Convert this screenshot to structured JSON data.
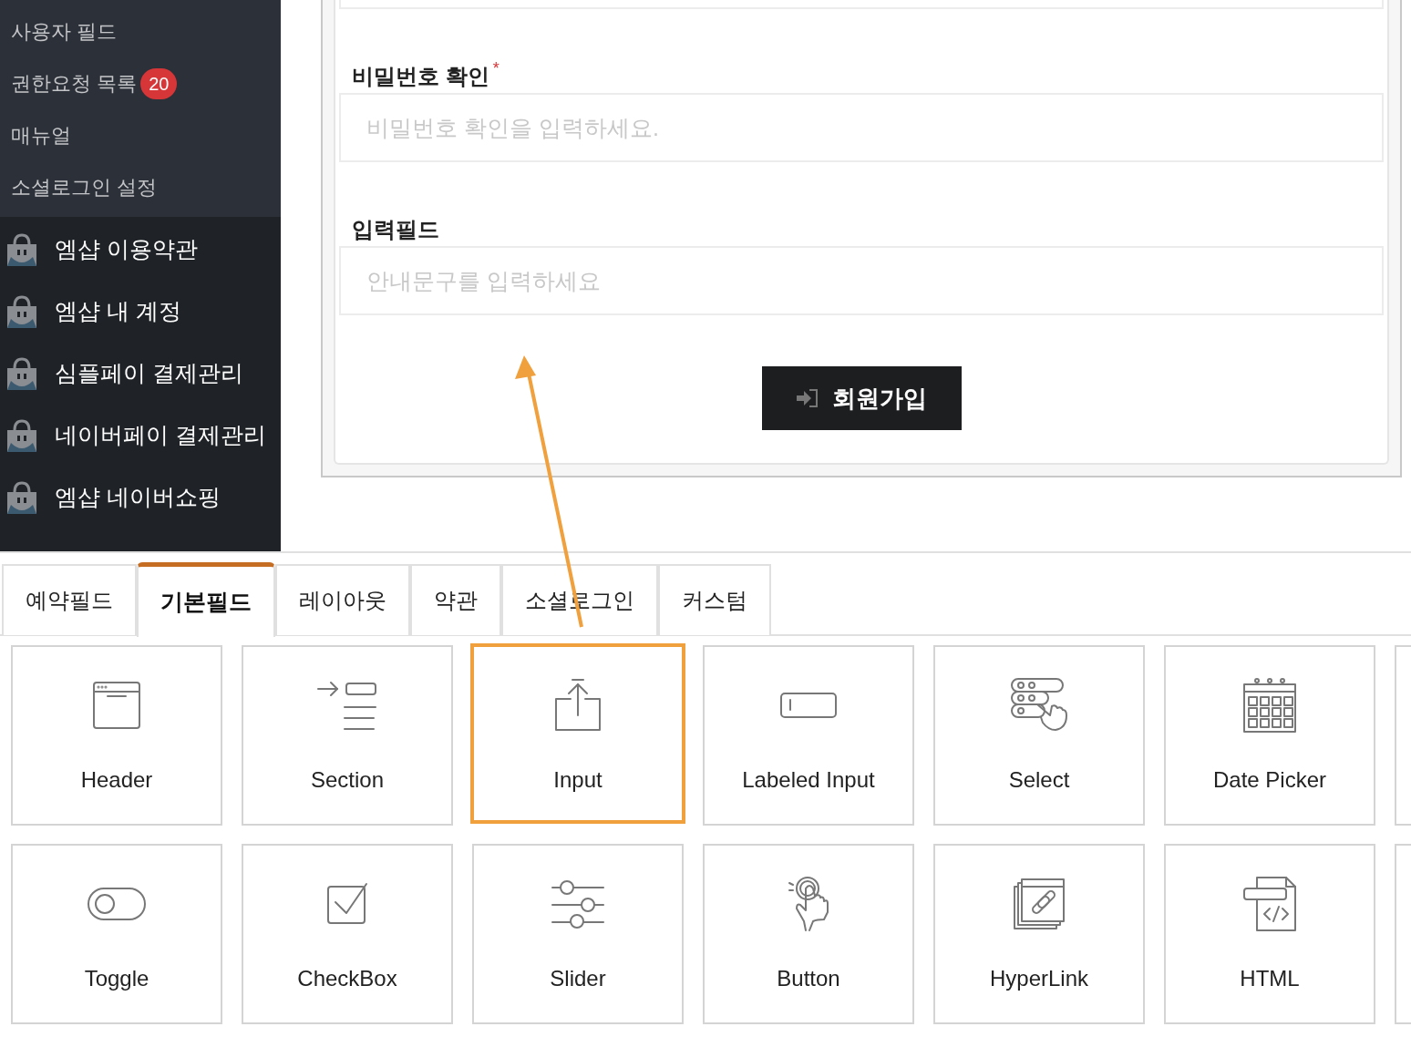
{
  "sidebar": {
    "submenu": [
      {
        "label": "사용자 필드"
      },
      {
        "label": "권한요청 목록",
        "badge": "20"
      },
      {
        "label": "매뉴얼"
      },
      {
        "label": "소셜로그인 설정"
      }
    ],
    "items": [
      {
        "label": "엠샵 이용약관"
      },
      {
        "label": "엠샵 내 계정"
      },
      {
        "label": "심플페이 결제관리"
      },
      {
        "label": "네이버페이 결제관리"
      },
      {
        "label": "엠샵 네이버쇼핑"
      }
    ]
  },
  "form": {
    "fields": [
      {
        "label": "비밀번호 확인",
        "required": true,
        "placeholder": "비밀번호 확인을 입력하세요."
      },
      {
        "label": "입력필드",
        "required": false,
        "placeholder": "안내문구를 입력하세요"
      }
    ],
    "required_mark": "*",
    "submit": "회원가입"
  },
  "tabs": [
    {
      "label": "예약필드",
      "selected": false
    },
    {
      "label": "기본필드",
      "selected": true
    },
    {
      "label": "레이아웃",
      "selected": false
    },
    {
      "label": "약관",
      "selected": false
    },
    {
      "label": "소셜로그인",
      "selected": false
    },
    {
      "label": "커스텀",
      "selected": false
    }
  ],
  "fields_palette": [
    {
      "kind": "header",
      "label": "Header",
      "highlighted": false
    },
    {
      "kind": "section",
      "label": "Section",
      "highlighted": false
    },
    {
      "kind": "input",
      "label": "Input",
      "highlighted": true
    },
    {
      "kind": "labeled-input",
      "label": "Labeled Input",
      "highlighted": false
    },
    {
      "kind": "select",
      "label": "Select",
      "highlighted": false
    },
    {
      "kind": "date-picker",
      "label": "Date Picker",
      "highlighted": false
    },
    {
      "kind": "toggle",
      "label": "Toggle",
      "highlighted": false
    },
    {
      "kind": "checkbox",
      "label": "CheckBox",
      "highlighted": false
    },
    {
      "kind": "slider",
      "label": "Slider",
      "highlighted": false
    },
    {
      "kind": "button",
      "label": "Button",
      "highlighted": false
    },
    {
      "kind": "hyperlink",
      "label": "HyperLink",
      "highlighted": false
    },
    {
      "kind": "html",
      "label": "HTML",
      "highlighted": false
    }
  ]
}
